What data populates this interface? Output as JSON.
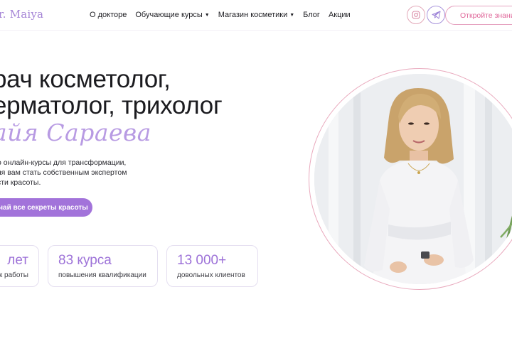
{
  "header": {
    "logo": "r. Maiya",
    "nav": [
      {
        "label": "О докторе",
        "dropdown": false
      },
      {
        "label": "Обучающие курсы",
        "dropdown": true
      },
      {
        "label": "Магазин косметики",
        "dropdown": true
      },
      {
        "label": "Блог",
        "dropdown": false
      },
      {
        "label": "Акции",
        "dropdown": false
      }
    ],
    "social": [
      "instagram-icon",
      "telegram-icon"
    ],
    "cta_label": "Откройте знани"
  },
  "hero": {
    "title_line1": "рач косметолог,",
    "title_line2": "ерматолог, трихолог",
    "name": "айя Сараева",
    "description": [
      "о онлайн-курсы для трансформации,",
      "яя вам стать собственным экспертом",
      "сти красоты."
    ],
    "cta_label": "чай все секреты красоты"
  },
  "stats": [
    {
      "value": "лет",
      "label": "к работы"
    },
    {
      "value": "83 курса",
      "label": "повышения квалификации"
    },
    {
      "value": "13 000+",
      "label": "довольных клиентов"
    }
  ],
  "colors": {
    "accent": "#a273da",
    "logo": "#a585d6",
    "name": "#b89be3",
    "cta_border": "#e6a3c0",
    "ring": "#e9a9bd"
  }
}
